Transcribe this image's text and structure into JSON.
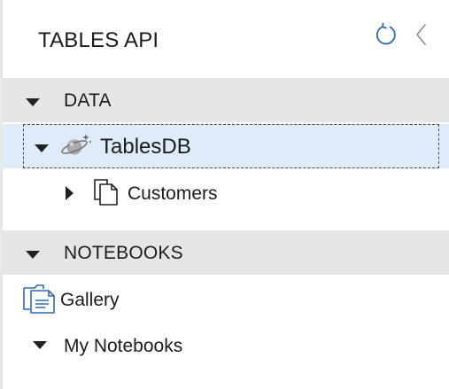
{
  "header": {
    "title": "TABLES API",
    "refresh_icon": "refresh-icon",
    "collapse_icon": "chevron-left-icon"
  },
  "sections": {
    "data": {
      "label": "DATA",
      "database": {
        "name": "TablesDB",
        "icon": "cosmos-planet-icon",
        "tables": [
          {
            "name": "Customers",
            "icon": "table-documents-icon"
          }
        ]
      }
    },
    "notebooks": {
      "label": "NOTEBOOKS",
      "gallery": {
        "label": "Gallery",
        "icon": "gallery-notebook-icon"
      },
      "my_notebooks": {
        "label": "My Notebooks"
      }
    }
  },
  "colors": {
    "section_bg": "#e6e6e6",
    "selected_bg": "#ddecf8",
    "accent": "#2b6cb0"
  }
}
